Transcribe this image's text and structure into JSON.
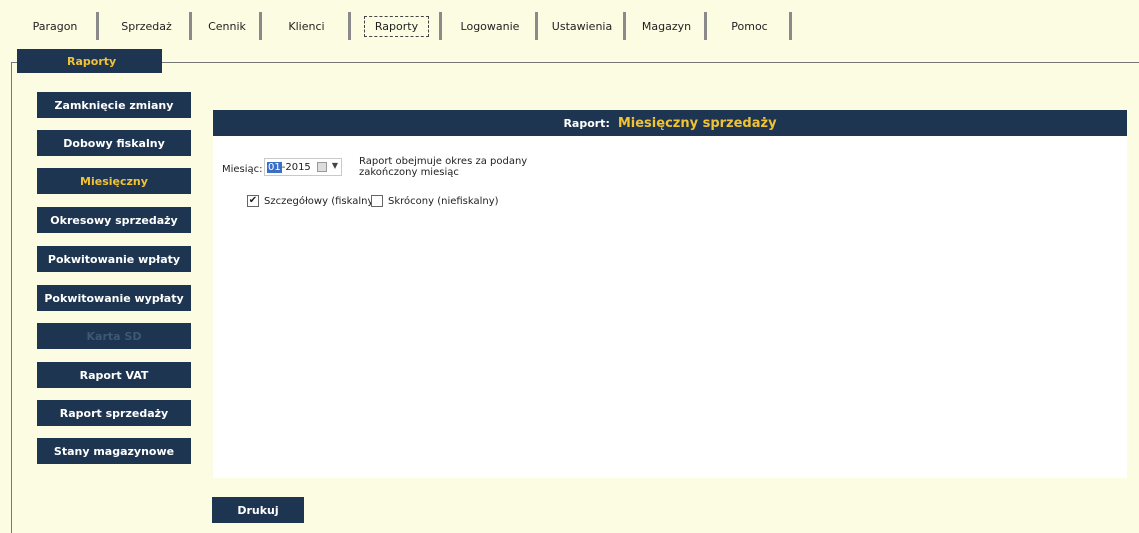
{
  "tabs": [
    {
      "label": "Paragon"
    },
    {
      "label": "Sprzedaż"
    },
    {
      "label": "Cennik"
    },
    {
      "label": "Klienci"
    },
    {
      "label": "Raporty"
    },
    {
      "label": "Logowanie"
    },
    {
      "label": "Ustawienia"
    },
    {
      "label": "Magazyn"
    },
    {
      "label": "Pomoc"
    }
  ],
  "section_title": "Raporty",
  "sidebar": {
    "items": [
      {
        "label": "Zamknięcie zmiany"
      },
      {
        "label": "Dobowy fiskalny"
      },
      {
        "label": "Miesięczny"
      },
      {
        "label": "Okresowy sprzedaży"
      },
      {
        "label": "Pokwitowanie wpłaty"
      },
      {
        "label": "Pokwitowanie wypłaty"
      },
      {
        "label": "Karta SD"
      },
      {
        "label": "Raport VAT"
      },
      {
        "label": "Raport sprzedaży"
      },
      {
        "label": "Stany magazynowe"
      }
    ]
  },
  "report": {
    "header_label": "Raport:",
    "header_value": "Miesięczny sprzedaży",
    "month_label": "Miesiąc:",
    "month_selected": "01",
    "month_rest": "-2015",
    "description": "Raport obejmuje okres za podany zakończony miesiąc",
    "option_detailed": "Szczegółowy (fiskalny)",
    "option_short": "Skrócony (niefiskalny)",
    "check_mark": "✔"
  },
  "print_label": "Drukuj"
}
